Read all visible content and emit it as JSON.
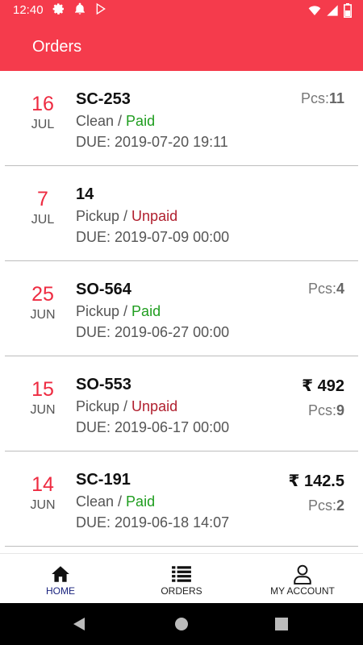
{
  "status_bar": {
    "time": "12:40",
    "icons": [
      "settings-icon",
      "notification-icon",
      "play-store-icon",
      "wifi-icon",
      "signal-icon",
      "battery-icon"
    ]
  },
  "app_bar": {
    "title": "Orders"
  },
  "colors": {
    "brand": "#f53b4c",
    "date_red": "#ee2b41",
    "paid_green": "#1f9d1f",
    "unpaid_red": "#b01f2e",
    "active_nav": "#1a237e"
  },
  "orders": [
    {
      "day": "16",
      "month": "JUL",
      "code": "SC-253",
      "type": "Clean",
      "separator": " / ",
      "payment": "Paid",
      "due": "DUE: 2019-07-20 19:11",
      "amount": "",
      "pcs_label": "Pcs:",
      "pcs": "11"
    },
    {
      "day": "7",
      "month": "JUL",
      "code": "14",
      "type": "Pickup",
      "separator": " / ",
      "payment": "Unpaid",
      "due": "DUE: 2019-07-09 00:00",
      "amount": "",
      "pcs_label": "",
      "pcs": ""
    },
    {
      "day": "25",
      "month": "JUN",
      "code": "SO-564",
      "type": "Pickup",
      "separator": " / ",
      "payment": "Paid",
      "due": "DUE: 2019-06-27 00:00",
      "amount": "",
      "pcs_label": "Pcs:",
      "pcs": "4"
    },
    {
      "day": "15",
      "month": "JUN",
      "code": "SO-553",
      "type": "Pickup",
      "separator": " / ",
      "payment": "Unpaid",
      "due": "DUE: 2019-06-17 00:00",
      "amount": "₹ 492",
      "pcs_label": "Pcs:",
      "pcs": "9"
    },
    {
      "day": "14",
      "month": "JUN",
      "code": "SC-191",
      "type": "Clean",
      "separator": " / ",
      "payment": "Paid",
      "due": "DUE: 2019-06-18 14:07",
      "amount": "₹ 142.5",
      "pcs_label": "Pcs:",
      "pcs": "2"
    }
  ],
  "bottom_nav": {
    "items": [
      {
        "label": "HOME",
        "icon": "home-icon",
        "active": true
      },
      {
        "label": "ORDERS",
        "icon": "list-icon",
        "active": false
      },
      {
        "label": "MY ACCOUNT",
        "icon": "account-icon",
        "active": false
      }
    ]
  },
  "system_nav": {
    "icons": [
      "back-icon",
      "home-circle-icon",
      "recents-icon"
    ]
  }
}
